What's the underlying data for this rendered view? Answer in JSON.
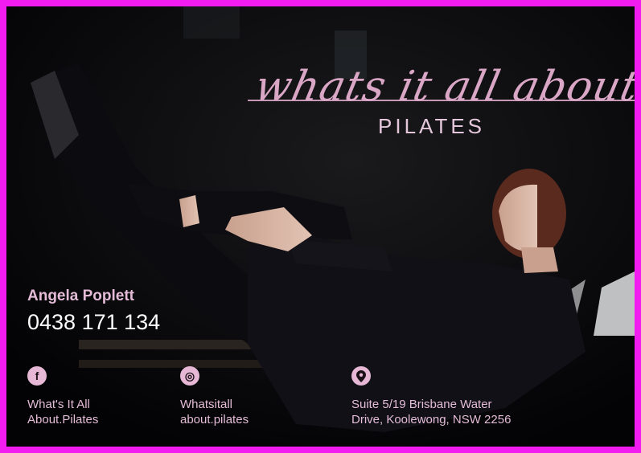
{
  "brand": {
    "script": "whats it all about...",
    "sub": "PILATES"
  },
  "contact": {
    "name": "Angela Poplett",
    "phone": "0438 171 134"
  },
  "social": [
    {
      "icon": "facebook-icon",
      "glyph": "f",
      "line1": "What's It All",
      "line2": "About.Pilates"
    },
    {
      "icon": "instagram-icon",
      "glyph": "◎",
      "line1": "Whatsitall",
      "line2": "about.pilates"
    },
    {
      "icon": "location-pin-icon",
      "glyph": "⬤",
      "line1": "Suite 5/19 Brisbane Water",
      "line2": "Drive, Koolewong, NSW 2256"
    }
  ],
  "colors": {
    "border": "#f21bf0",
    "background": "#050508",
    "accent_pink": "#e4bcd8",
    "badge": "#e6b8d6"
  }
}
